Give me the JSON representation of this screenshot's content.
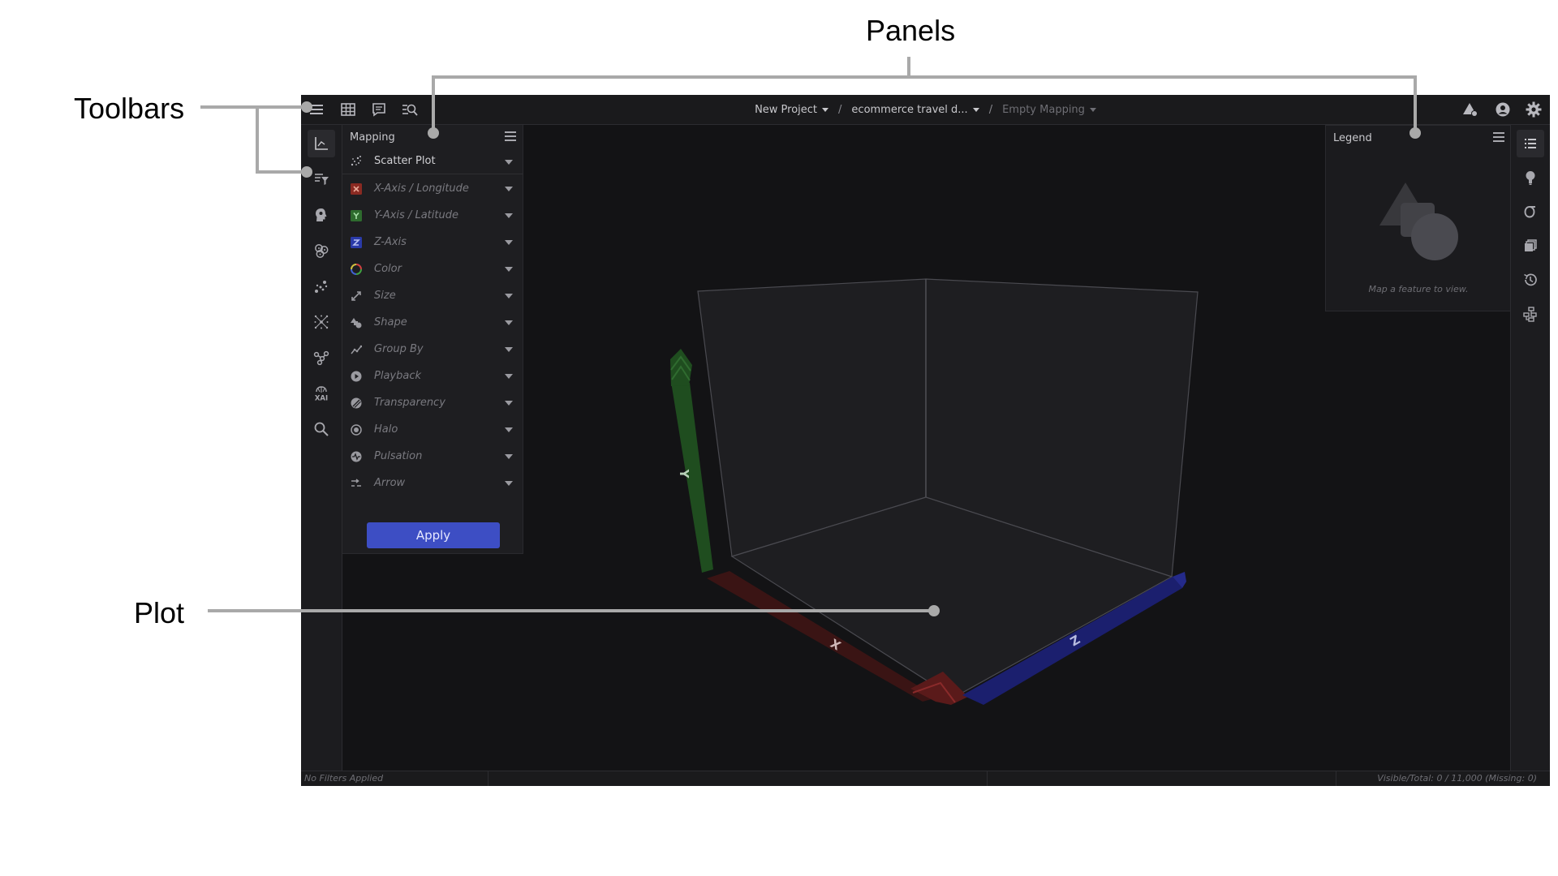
{
  "annotations": {
    "panels": "Panels",
    "toolbars": "Toolbars",
    "plot": "Plot"
  },
  "breadcrumb": {
    "project": "New Project",
    "dataset": "ecommerce travel d...",
    "mapping": "Empty Mapping",
    "separator": "/"
  },
  "mapping_panel": {
    "title": "Mapping",
    "plot_type": "Scatter Plot",
    "rows": [
      {
        "label": "X-Axis / Longitude",
        "icon": "x-axis-icon",
        "color": "#c0392b"
      },
      {
        "label": "Y-Axis / Latitude",
        "icon": "y-axis-icon",
        "color": "#2e7d32"
      },
      {
        "label": "Z-Axis",
        "icon": "z-axis-icon",
        "color": "#283593"
      },
      {
        "label": "Color",
        "icon": "color-wheel-icon"
      },
      {
        "label": "Size",
        "icon": "resize-icon"
      },
      {
        "label": "Shape",
        "icon": "shapes-icon"
      },
      {
        "label": "Group By",
        "icon": "group-by-icon"
      },
      {
        "label": "Playback",
        "icon": "play-icon"
      },
      {
        "label": "Transparency",
        "icon": "transparency-icon"
      },
      {
        "label": "Halo",
        "icon": "halo-icon"
      },
      {
        "label": "Pulsation",
        "icon": "pulsation-icon"
      },
      {
        "label": "Arrow",
        "icon": "arrow-icon"
      }
    ],
    "apply_label": "Apply"
  },
  "legend_panel": {
    "title": "Legend",
    "hint": "Map a feature to view."
  },
  "axes": {
    "x": "X",
    "y": "Y",
    "z": "Z",
    "x_color": "#7a1e1e",
    "y_color": "#1f4d1f",
    "z_color": "#1b1f6e"
  },
  "status": {
    "filters": "No Filters Applied",
    "counts": "Visible/Total: 0 / 11,000 (Missing: 0)"
  },
  "left_toolbar_icons": [
    "axis-chart-icon",
    "filter-icon",
    "head-ai-icon",
    "cluster-icon",
    "scatter-icon",
    "network-icon",
    "graph-icon",
    "xai-icon",
    "search-icon"
  ],
  "right_toolbar_icons": [
    "legend-list-icon",
    "insight-bulb-icon",
    "sigma-icon",
    "layers-icon",
    "history-icon",
    "hierarchy-icon"
  ],
  "accent_color": "#3d4ec4"
}
